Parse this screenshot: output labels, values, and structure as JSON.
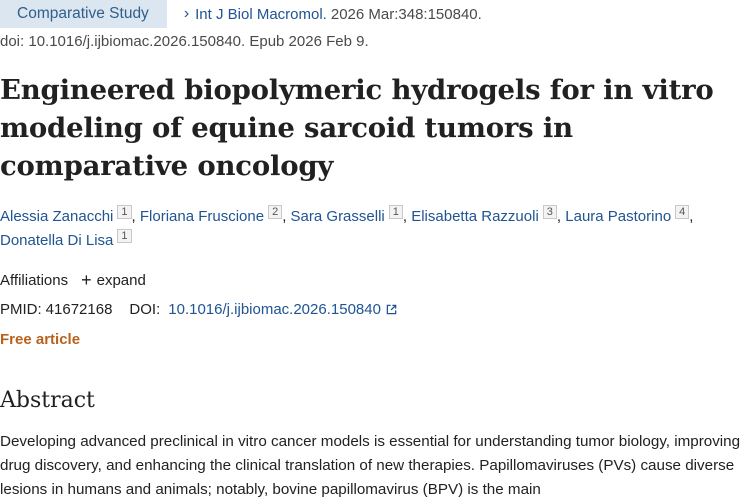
{
  "header": {
    "publication_type": "Comparative Study",
    "journal": "Int J Biol Macromol.",
    "citation": "2026 Mar:348:150840.",
    "doi_line": "doi: 10.1016/j.ijbiomac.2026.150840. Epub 2026 Feb 9."
  },
  "title": "Engineered biopolymeric hydrogels for in vitro modeling of equine sarcoid tumors in comparative oncology",
  "authors": [
    {
      "name": "Alessia Zanacchi",
      "affil": "1"
    },
    {
      "name": "Floriana Fruscione",
      "affil": "2"
    },
    {
      "name": "Sara Grasselli",
      "affil": "1"
    },
    {
      "name": "Elisabetta Razzuoli",
      "affil": "3"
    },
    {
      "name": "Laura Pastorino",
      "affil": "4"
    },
    {
      "name": "Donatella Di Lisa",
      "affil": "1"
    }
  ],
  "author_separator": ", ",
  "affiliations": {
    "label": "Affiliations",
    "expand_label": "expand"
  },
  "identifiers": {
    "pmid_label": "PMID:",
    "pmid": "41672168",
    "doi_label": "DOI:",
    "doi": "10.1016/j.ijbiomac.2026.150840"
  },
  "free_article_label": "Free article",
  "abstract": {
    "heading": "Abstract",
    "text": "Developing advanced preclinical in vitro cancer models is essential for understanding tumor biology, improving drug discovery, and enhancing the clinical translation of new therapies. Papillomaviruses (PVs) cause diverse lesions in humans and animals; notably, bovine papillomavirus (BPV) is the main"
  },
  "colors": {
    "link": "#205493",
    "badge_bg": "#dbe6f1",
    "free_article": "#b9621d"
  }
}
